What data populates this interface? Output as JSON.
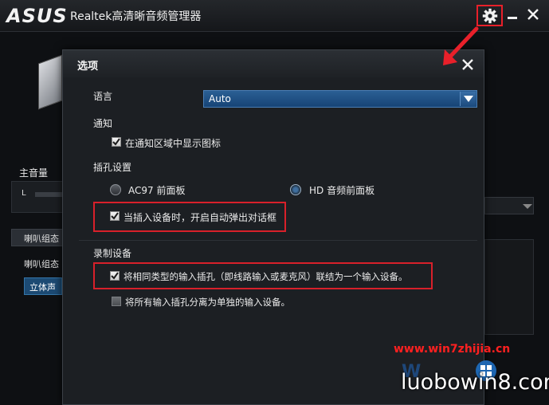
{
  "app": {
    "brand": "ASUS",
    "title": "Realtek高清晰音频管理器",
    "main_volume_label": "主音量",
    "channel_l": "L",
    "tab_label": "喇叭组态",
    "sub_label": "喇叭组态",
    "stereo_button": "立体声"
  },
  "dialog": {
    "title": "选项",
    "language": {
      "label": "语言",
      "selected": "Auto"
    },
    "notify": {
      "label": "通知",
      "show_tray_icon": {
        "label": "在通知区域中显示图标",
        "checked": true
      }
    },
    "jack": {
      "label": "插孔设置",
      "radio_ac97": {
        "label": "AC97 前面板",
        "selected": false
      },
      "radio_hd": {
        "label": "HD 音频前面板",
        "selected": true
      },
      "auto_popup": {
        "label": "当插入设备时，开启自动弹出对话框",
        "checked": true
      }
    },
    "recording": {
      "label": "录制设备",
      "tie_inputs": {
        "label": "将相同类型的输入插孔（即线路输入或麦克风）联结为一个输入设备。",
        "checked": true
      },
      "separate_inputs": {
        "label": "将所有输入插孔分离为单独的输入设备。",
        "checked": false
      }
    }
  },
  "watermark": {
    "url": "www.win7zhijia.cn",
    "site": "luobowin8.com"
  },
  "colors": {
    "highlight_red": "#d8202a",
    "select_blue": "#1f4f84"
  }
}
